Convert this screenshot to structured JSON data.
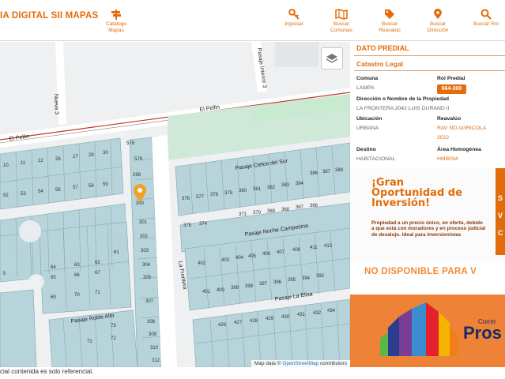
{
  "header": {
    "brand": "IA DIGITAL SII MAPAS",
    "nav": [
      {
        "label": "Catálogo\nMapas",
        "icon": "signpost-icon"
      },
      {
        "label": "Ingresar",
        "icon": "key-icon"
      },
      {
        "label": "Buscar\nComunas",
        "icon": "map-icon"
      },
      {
        "label": "Buscar\nReavalúo",
        "icon": "price-tag-icon"
      },
      {
        "label": "Buscar\nDirección",
        "icon": "location-pin-icon"
      },
      {
        "label": "Buscar Rol",
        "icon": "search-icon"
      }
    ]
  },
  "map": {
    "streets": [
      "El Pellin",
      "El Pellin",
      "Pasaje Interior 3",
      "Nueva 3",
      "Pasaje Cielos del Sur",
      "Pasaje Noche Campesina",
      "La Frontera",
      "Pasaje La Elisa",
      "Pasaje Roble Alto"
    ],
    "attribution_prefix": "Map data ©",
    "attribution_link": "OpenStreetMap",
    "attribution_suffix": "contributors"
  },
  "footer_note": "cial contenida es solo referencial.",
  "panel": {
    "title": "DATO PREDIAL",
    "subtitle": "Catastro Legal",
    "comuna_label": "Comuna",
    "comuna_value": "LAMPA",
    "rol_label": "Rol Predial",
    "rol_value": "664-300",
    "direccion_label": "Dirección o Nombre de la Propiedad",
    "direccion_value": "LA FRONTERA 2042 LUIS DURAND II",
    "ubicacion_label": "Ubicación",
    "ubicacion_value": "URBANA",
    "reavaluo_label": "Reavalúo",
    "reavaluo_value_1": "RAV NO AGRICOLA",
    "reavaluo_value_2": "2022",
    "destino_label": "Destino",
    "destino_value": "HABITACIONAL",
    "area_label": "Área Homogénea",
    "area_value": "HMB034"
  },
  "ad": {
    "gran": "¡Gran Oportunidad de Inversión!",
    "text": "Propiedad a un precio único, en oferta, debido a que está con moradores y en proceso judicial de desalojo. Ideal para inversionistas",
    "right_letters": "S V C",
    "no_disponible": "NO DISPONIBLE PARA V",
    "brand_small": "Corret",
    "brand_big": "Pros"
  },
  "colors": {
    "accent": "#e36c0a",
    "parcel": "#b7d4da",
    "parcel_stroke": "#7fa6ae",
    "road": "#ffffff"
  }
}
